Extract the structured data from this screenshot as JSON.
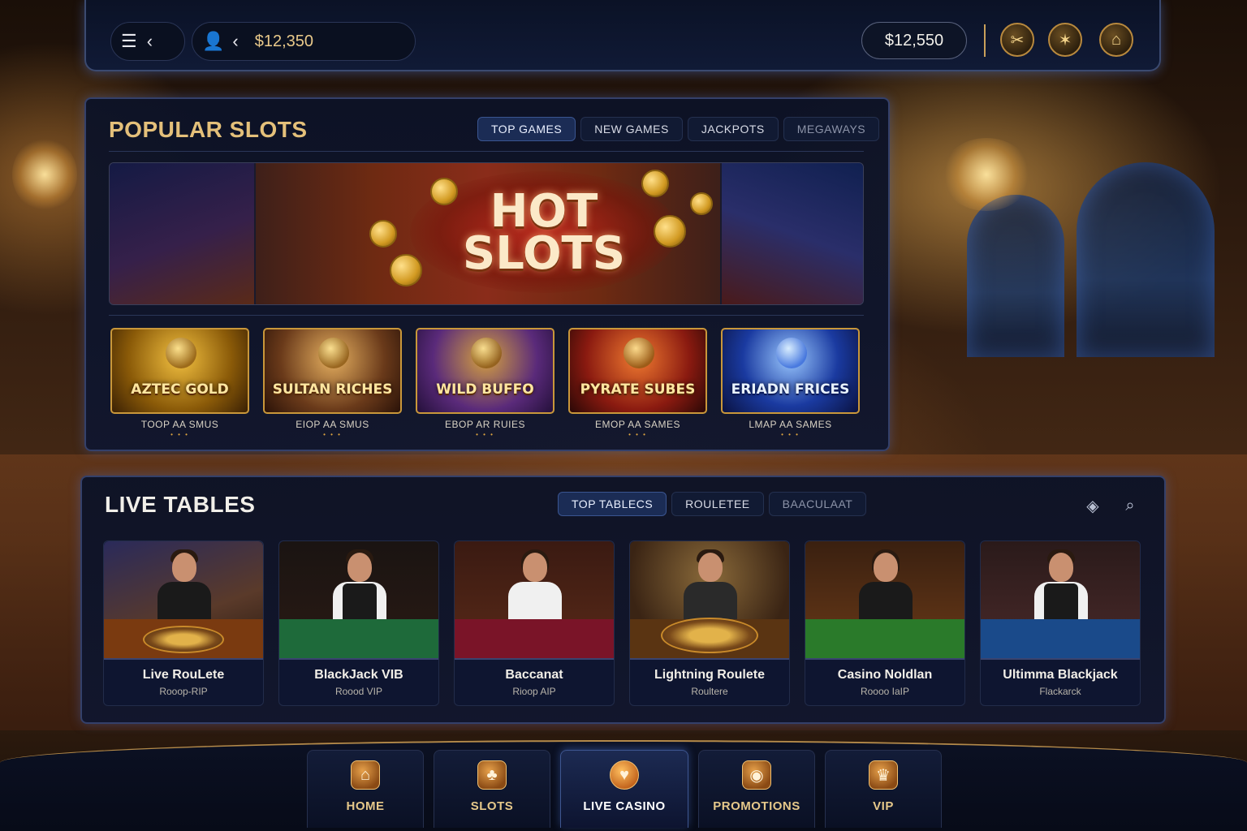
{
  "topbar": {
    "balance_left": "$12,350",
    "balance_right": "$12,550",
    "icons": [
      "menu-icon",
      "back-icon",
      "profile-icon",
      "back-icon",
      "sword-icon",
      "star-icon",
      "lock-icon"
    ]
  },
  "slots_section": {
    "title": "POPULAR SLOTS",
    "tabs": [
      {
        "label": "TOP GAMES",
        "active": true
      },
      {
        "label": "NEW GAMES",
        "active": false
      },
      {
        "label": "JACKPOTS",
        "active": false
      },
      {
        "label": "MEGAWAYS",
        "active": false
      }
    ],
    "hero": {
      "title_line1": "HOT",
      "title_line2": "SLOTS"
    },
    "games": [
      {
        "name": "AZTEC GOLD",
        "sub": "TOOP AA SMUS",
        "dots": "• • •",
        "color": "#b07a10"
      },
      {
        "name": "SULTAN RICHES",
        "sub": "EIOP AA SMUS",
        "dots": "• • •",
        "color": "#7a5a20"
      },
      {
        "name": "WILD BUFFO",
        "sub": "EBOP AR RUIES",
        "dots": "• • •",
        "color": "#5a2a6a"
      },
      {
        "name": "PYRATE SUBES",
        "sub": "EMOP AA SAMES",
        "dots": "• • •",
        "color": "#8a2010"
      },
      {
        "name": "ERIADN FRICES",
        "sub": "LMAP AA SAMES",
        "dots": "• • •",
        "color": "#1a3a9a"
      }
    ]
  },
  "tables_section": {
    "title": "LIVE TABLES",
    "tabs": [
      {
        "label": "TOP TABLECS",
        "active": true
      },
      {
        "label": "ROULETEE",
        "active": false
      },
      {
        "label": "BAACULAAT",
        "active": false
      }
    ],
    "icons": [
      "diamond-icon",
      "search-icon"
    ],
    "tables": [
      {
        "name": "Live RouLete",
        "sub": "Rooop-RIP",
        "felt": "#7a3a10",
        "bg": "#2a2a5a"
      },
      {
        "name": "BlackJack VIB",
        "sub": "Roood VIP",
        "felt": "#1e6a3a",
        "bg": "#1a1412"
      },
      {
        "name": "Baccanat",
        "sub": "Rioop AIP",
        "felt": "#7a1428",
        "bg": "#3a1a12"
      },
      {
        "name": "Lightning Roulete",
        "sub": "Roultere",
        "felt": "#5a3412",
        "bg": "#3a2414"
      },
      {
        "name": "Casino Noldlan",
        "sub": "Roooo IaIP",
        "felt": "#2a7a2a",
        "bg": "#3a2010"
      },
      {
        "name": "Ultimma Blackjack",
        "sub": "Flackarck",
        "felt": "#1a4a8a",
        "bg": "#2a1a1a"
      }
    ]
  },
  "bottom_nav": [
    {
      "label": "HOME",
      "icon": "home-icon",
      "active": false
    },
    {
      "label": "SLOTS",
      "icon": "slots-icon",
      "active": false
    },
    {
      "label": "LIVE CASINO",
      "icon": "heart-icon",
      "active": true
    },
    {
      "label": "PROMOTIONS",
      "icon": "promo-icon",
      "active": false
    },
    {
      "label": "VIP",
      "icon": "vip-icon",
      "active": false
    }
  ]
}
